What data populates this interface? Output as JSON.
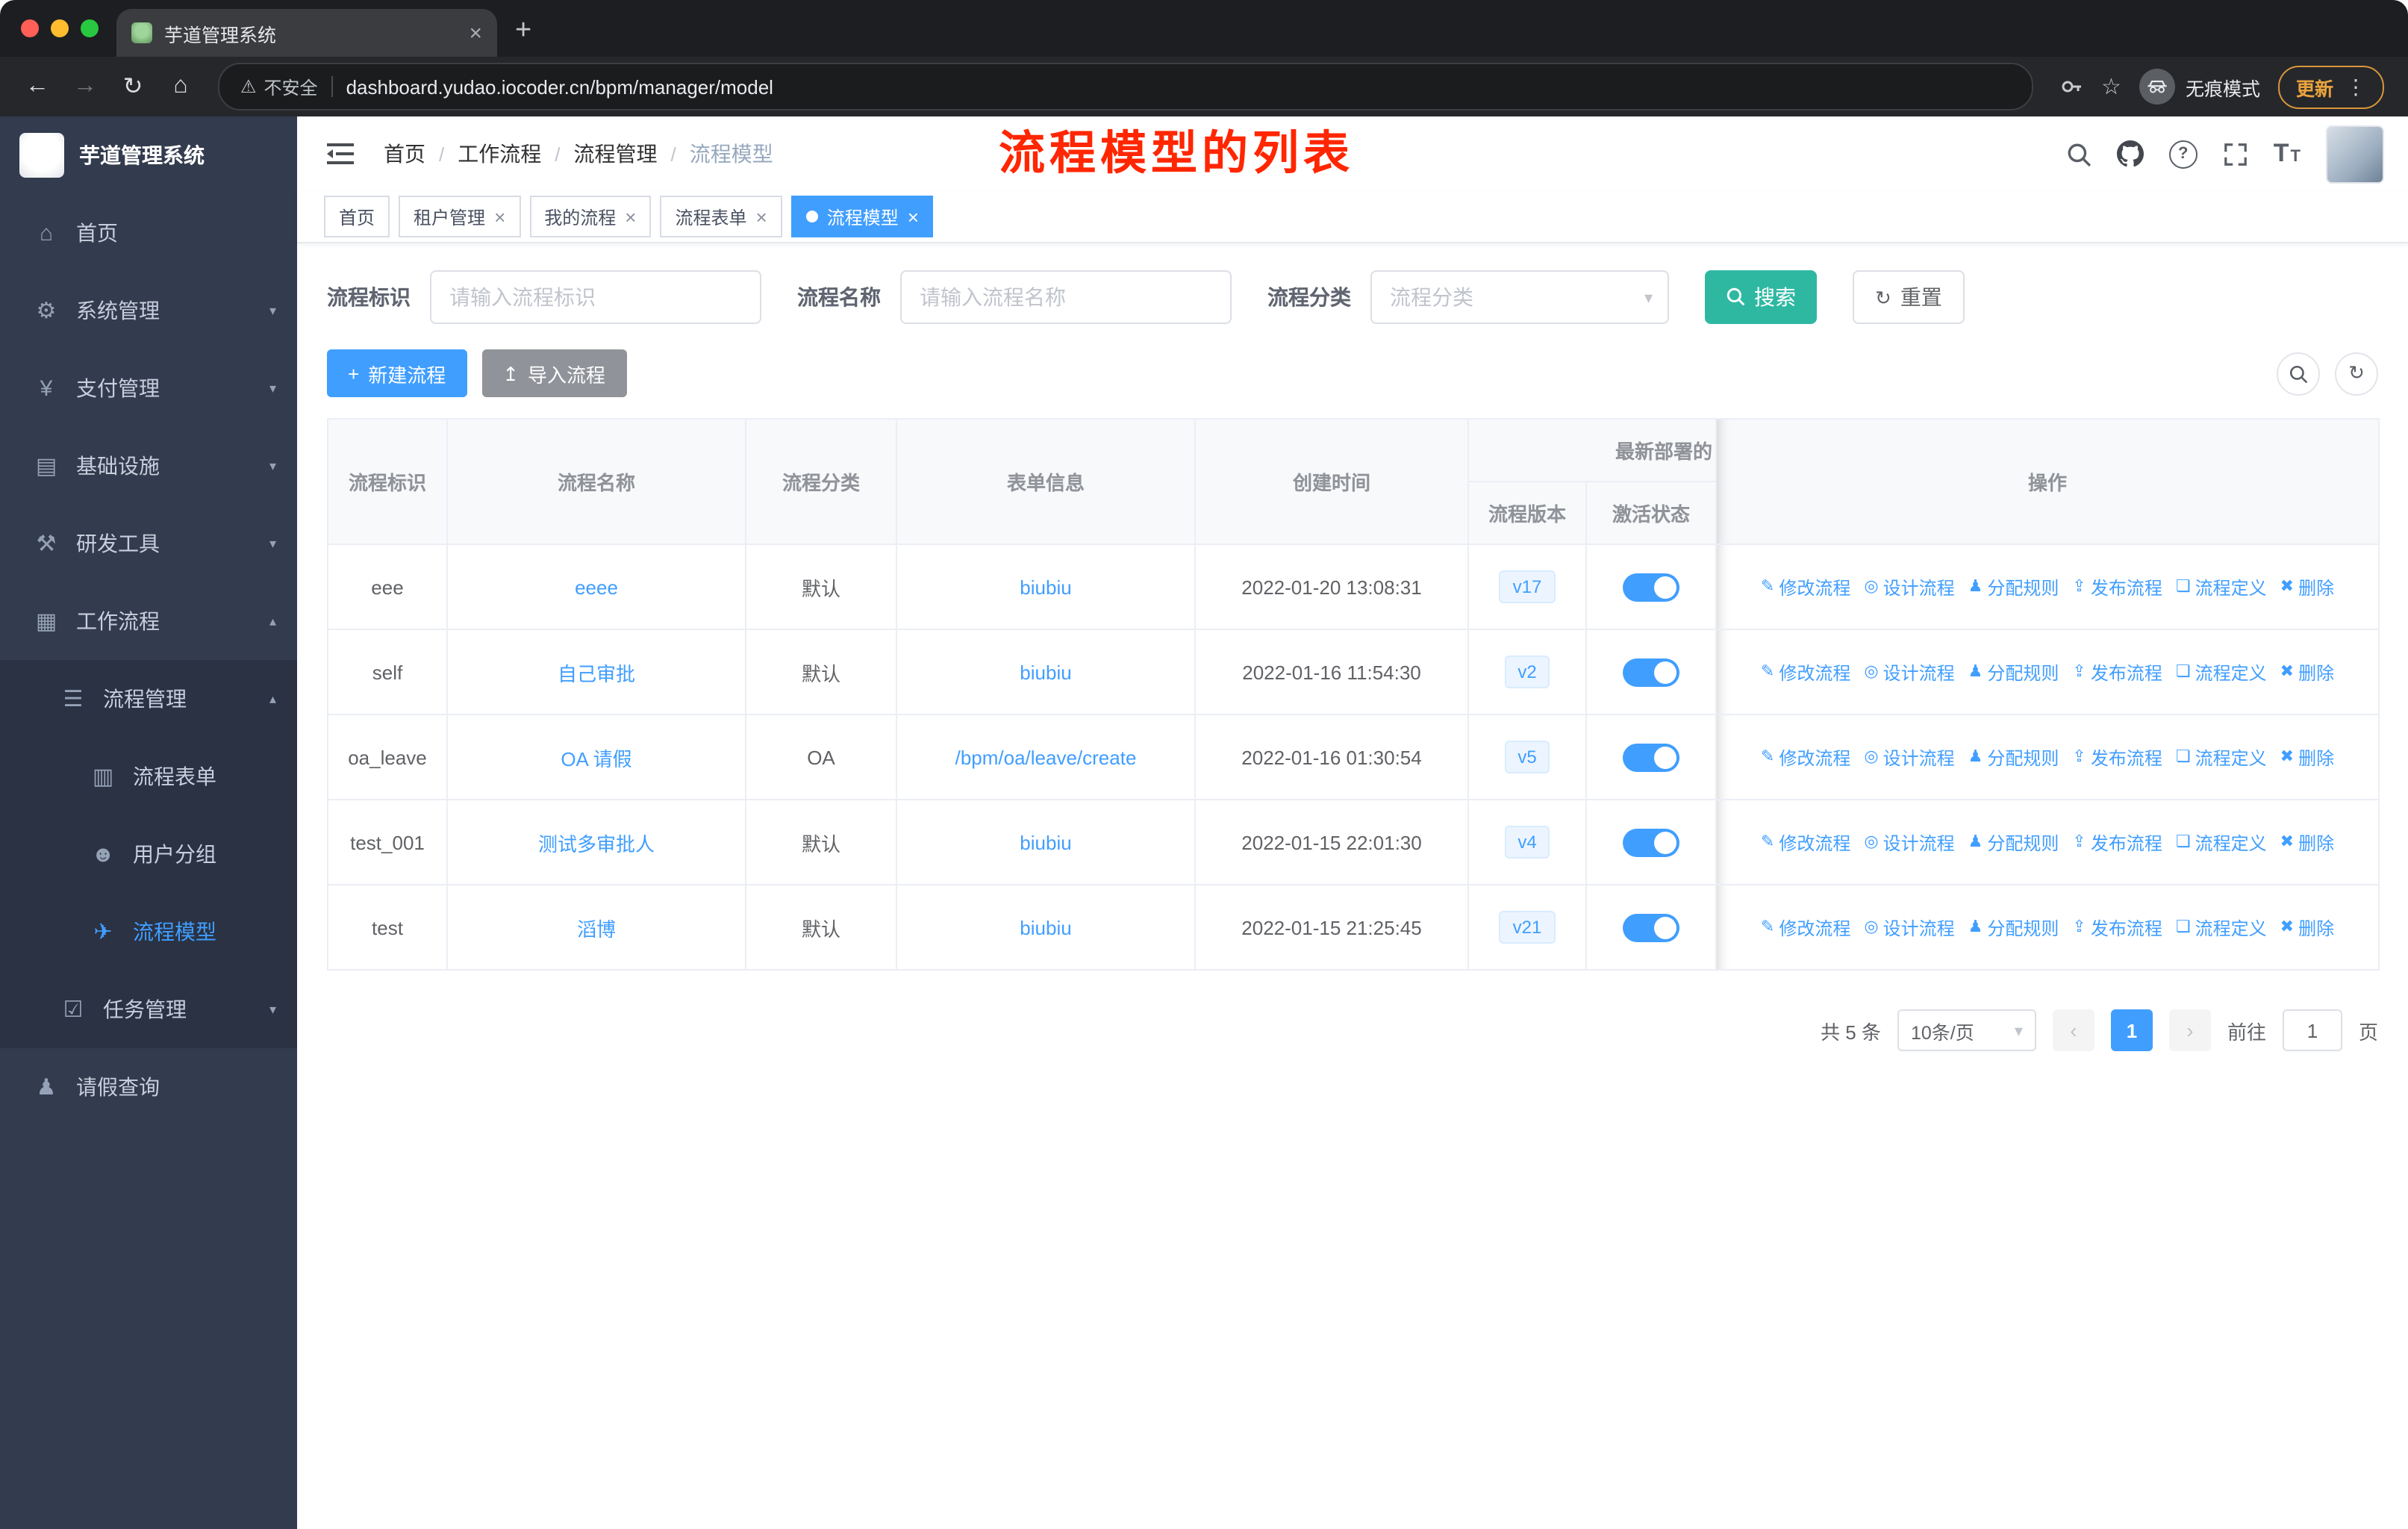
{
  "browser": {
    "tab_title": "芋道管理系统",
    "security_label": "不安全",
    "url": "dashboard.yudao.iocoder.cn/bpm/manager/model",
    "incognito_label": "无痕模式",
    "update_label": "更新"
  },
  "sidebar": {
    "app_title": "芋道管理系统",
    "menu": [
      {
        "label": "首页"
      },
      {
        "label": "系统管理"
      },
      {
        "label": "支付管理"
      },
      {
        "label": "基础设施"
      },
      {
        "label": "研发工具"
      },
      {
        "label": "工作流程"
      },
      {
        "label": "流程管理"
      },
      {
        "label": "流程表单"
      },
      {
        "label": "用户分组"
      },
      {
        "label": "流程模型"
      },
      {
        "label": "任务管理"
      },
      {
        "label": "请假查询"
      }
    ]
  },
  "navbar": {
    "breadcrumb": [
      "首页",
      "工作流程",
      "流程管理",
      "流程模型"
    ],
    "annotation": "流程模型的列表"
  },
  "tags": [
    "首页",
    "租户管理",
    "我的流程",
    "流程表单",
    "流程模型"
  ],
  "filter": {
    "fields": [
      {
        "label": "流程标识",
        "placeholder": "请输入流程标识"
      },
      {
        "label": "流程名称",
        "placeholder": "请输入流程名称"
      },
      {
        "label": "流程分类",
        "placeholder": "流程分类"
      }
    ],
    "search_label": "搜索",
    "reset_label": "重置"
  },
  "toolbar": {
    "create_label": "新建流程",
    "import_label": "导入流程"
  },
  "table": {
    "columns": [
      "流程标识",
      "流程名称",
      "流程分类",
      "表单信息",
      "创建时间",
      "流程版本",
      "激活状态",
      "操作"
    ],
    "group_header": "最新部署的",
    "actions": [
      "修改流程",
      "设计流程",
      "分配规则",
      "发布流程",
      "流程定义",
      "删除"
    ],
    "rows": [
      {
        "key": "eee",
        "name": "eeee",
        "category": "默认",
        "form": "biubiu",
        "created": "2022-01-20 13:08:31",
        "version": "v17"
      },
      {
        "key": "self",
        "name": "自己审批",
        "category": "默认",
        "form": "biubiu",
        "created": "2022-01-16 11:54:30",
        "version": "v2"
      },
      {
        "key": "oa_leave",
        "name": "OA 请假",
        "category": "OA",
        "form": "/bpm/oa/leave/create",
        "created": "2022-01-16 01:30:54",
        "version": "v5"
      },
      {
        "key": "test_001",
        "name": "测试多审批人",
        "category": "默认",
        "form": "biubiu",
        "created": "2022-01-15 22:01:30",
        "version": "v4"
      },
      {
        "key": "test",
        "name": "滔博",
        "category": "默认",
        "form": "biubiu",
        "created": "2022-01-15 21:25:45",
        "version": "v21"
      }
    ]
  },
  "pagination": {
    "total": "共 5 条",
    "page_size": "10条/页",
    "current": "1",
    "goto_label": "前往",
    "goto_value": "1",
    "page_unit": "页"
  },
  "colors": {
    "accent": "#409eff",
    "search_button": "#2eb8a2",
    "annotation_red": "#ff2600"
  }
}
